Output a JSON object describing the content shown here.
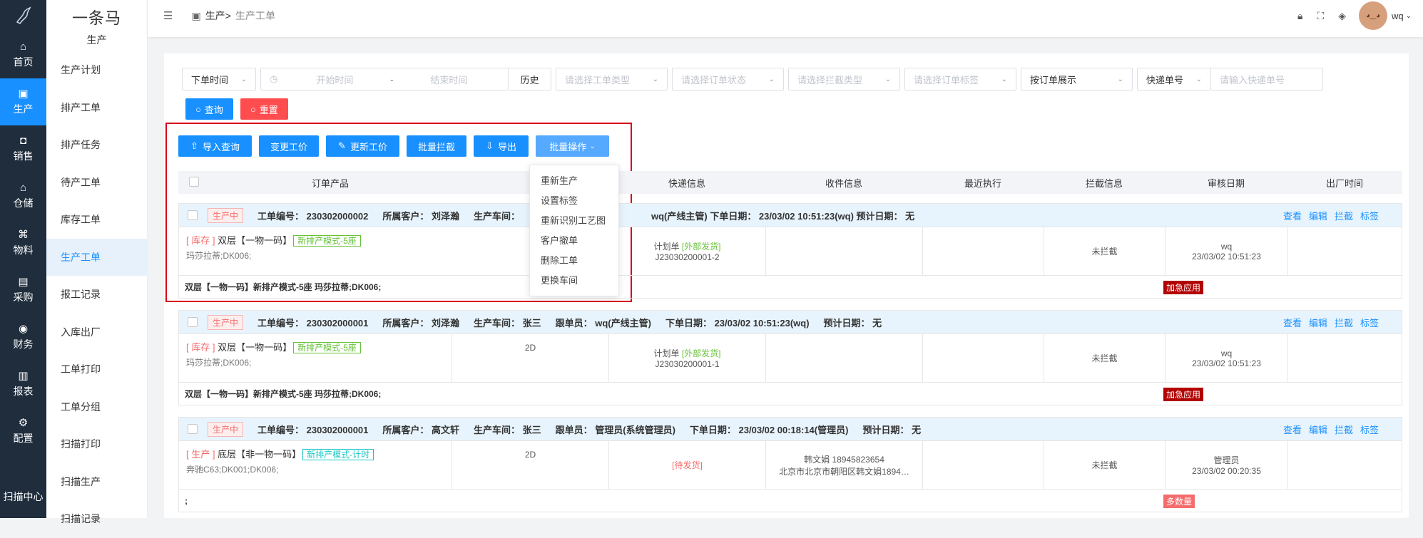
{
  "nav": {
    "items": [
      {
        "label": "首页",
        "icon": "home-icon",
        "glyph": "⌂"
      },
      {
        "label": "生产",
        "icon": "production-icon",
        "glyph": "▣"
      },
      {
        "label": "销售",
        "icon": "sales-icon",
        "glyph": "◘"
      },
      {
        "label": "仓储",
        "icon": "storage-icon",
        "glyph": "⌂"
      },
      {
        "label": "物料",
        "icon": "material-icon",
        "glyph": "⌘"
      },
      {
        "label": "采购",
        "icon": "purchase-icon",
        "glyph": "▤"
      },
      {
        "label": "财务",
        "icon": "finance-icon",
        "glyph": "◉"
      },
      {
        "label": "报表",
        "icon": "report-icon",
        "glyph": "▥"
      },
      {
        "label": "配置",
        "icon": "config-icon",
        "glyph": "⚙"
      }
    ],
    "scan_center": "扫描中心"
  },
  "side": {
    "brand": "一条马",
    "section": "生产",
    "items": [
      "生产计划",
      "排产工单",
      "排产任务",
      "待产工单",
      "库存工单",
      "生产工单",
      "报工记录",
      "入库出厂",
      "工单打印",
      "工单分组",
      "扫描打印",
      "扫描生产",
      "扫描记录"
    ]
  },
  "header": {
    "breadcrumb_root": "生产>",
    "breadcrumb_current": "生产工单",
    "user": "wq"
  },
  "filters": {
    "order_time": "下单时间",
    "start_placeholder": "开始时间",
    "sep": "-",
    "end_placeholder": "结束时间",
    "history": "历史",
    "work_type": "请选择工单类型",
    "order_status": "请选择订单状态",
    "intercept_type": "请选择拦截类型",
    "order_tag": "请选择订单标签",
    "display_by": "按订单展示",
    "express_no": "快递单号",
    "express_input_placeholder": "请输入快递单号",
    "query": "查询",
    "reset": "重置"
  },
  "actions": {
    "import_query": "导入查询",
    "change_price": "变更工价",
    "update_price": "更新工价",
    "batch_intercept": "批量拦截",
    "export": "导出",
    "batch_ops": "批量操作"
  },
  "dropdown": [
    "重新生产",
    "设置标签",
    "重新识别工艺图",
    "客户撤单",
    "删除工单",
    "更换车间"
  ],
  "columns": [
    "订单产品",
    "快递信息",
    "收件信息",
    "最近执行",
    "拦截信息",
    "审核日期",
    "出厂时间"
  ],
  "colors": {
    "primary": "#1890ff",
    "danger": "#ff4d4f",
    "nav_bg": "#1f2d3d",
    "urgent": "#b30000",
    "qty": "#f56c6c"
  },
  "orders": [
    {
      "status": "生产中",
      "header": [
        "工单编号： 230302000002",
        "所属客户： 刘泽瀚",
        "生产车间："
      ],
      "header_tail": "wq(产线主管)   下单日期： 23/03/02 10:51:23(wq)   预计日期： 无",
      "ops": [
        "查看",
        "编辑",
        "拦截",
        "标签"
      ],
      "stock": "[ 库存 ]",
      "product": "双层【一物一码】",
      "product_tag": "新排产模式-5座",
      "spec": "玛莎拉蒂;DK006;",
      "express_a": "计划单",
      "express_b": "[外部发货]",
      "express_no": "J23030200001-2",
      "intercept": "未拦截",
      "audit_user": "wq",
      "audit_time": "23/03/02 10:51:23",
      "footer": "双层【一物一码】新排产模式-5座 玛莎拉蒂;DK006;",
      "badge": "加急应用"
    },
    {
      "status": "生产中",
      "header": [
        "工单编号： 230302000001",
        "所属客户： 刘泽瀚",
        "生产车间： 张三",
        "跟单员： wq(产线主管)",
        "下单日期： 23/03/02 10:51:23(wq)",
        "预计日期： 无"
      ],
      "ops": [
        "查看",
        "编辑",
        "拦截",
        "标签"
      ],
      "stock": "[ 库存 ]",
      "product": "双层【一物一码】",
      "product_tag": "新排产模式-5座",
      "spec": "玛莎拉蒂;DK006;",
      "qty": "2D",
      "express_a": "计划单",
      "express_b": "[外部发货]",
      "express_no": "J23030200001-1",
      "intercept": "未拦截",
      "audit_user": "wq",
      "audit_time": "23/03/02 10:51:23",
      "footer": "双层【一物一码】新排产模式-5座 玛莎拉蒂;DK006;",
      "badge": "加急应用"
    },
    {
      "status": "生产中",
      "header": [
        "工单编号： 230302000001",
        "所属客户： 高文轩",
        "生产车间： 张三",
        "跟单员： 管理员(系统管理员)",
        "下单日期： 23/03/02 00:18:14(管理员)",
        "预计日期： 无"
      ],
      "ops": [
        "查看",
        "编辑",
        "拦截",
        "标签"
      ],
      "stock": "[ 生产 ]",
      "product": "底层【非一物一码】",
      "product_tag": "新排产模式-计时",
      "spec": "奔驰C63;DK001;DK006;",
      "qty": "2D",
      "express_pending": "[待发货]",
      "recv_a": "韩文娟 18945823654",
      "recv_b": "北京市北京市朝阳区韩文娟1894…",
      "intercept": "未拦截",
      "audit_user": "管理员",
      "audit_time": "23/03/02 00:20:35",
      "footer": ";",
      "badge": "多数量"
    }
  ]
}
